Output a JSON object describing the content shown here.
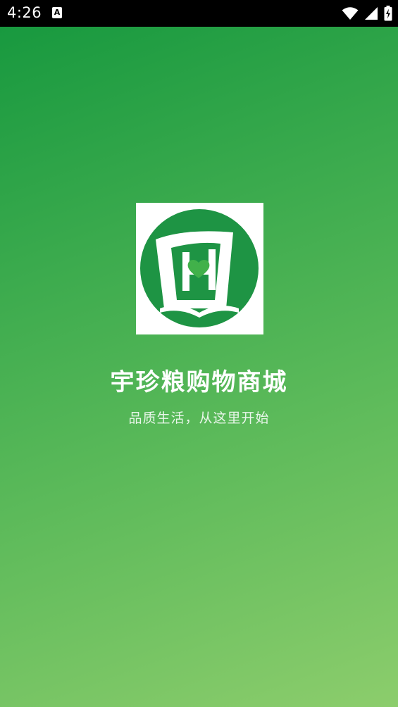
{
  "status_bar": {
    "time": "4:26",
    "notification_glyph": "A",
    "icons": [
      "wifi-icon",
      "cell-signal-icon",
      "battery-charging-icon"
    ]
  },
  "splash": {
    "app_name": "宇珍粮购物商城",
    "slogan": "品质生活，从这里开始",
    "logo_icon": "app-logo-icon",
    "colors": {
      "gradient_start": "#18993f",
      "gradient_end": "#8ccd6c",
      "logo_green": "#1e9444",
      "heart_green": "#41b14a"
    }
  }
}
